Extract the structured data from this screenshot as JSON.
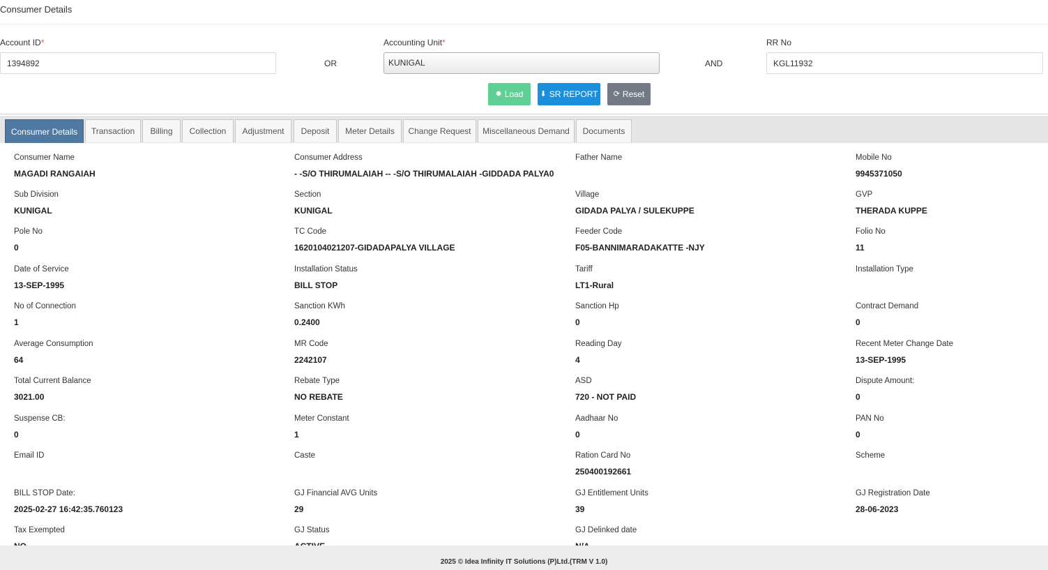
{
  "page": {
    "title": "Consumer Details"
  },
  "form": {
    "account_id": {
      "label": "Account ID",
      "required_mark": "*",
      "value": "1394892"
    },
    "or_text": "OR",
    "accounting_unit": {
      "label": "Accounting Unit",
      "required_mark": "*",
      "selected": "KUNIGAL"
    },
    "and_text": "AND",
    "rr_no": {
      "label": "RR No",
      "value": "KGL11932"
    }
  },
  "buttons": {
    "load": {
      "label": "Load",
      "icon": "spinner-icon"
    },
    "sr_report": {
      "label": "SR REPORT",
      "icon": "arrow-circle-down-icon"
    },
    "reset": {
      "label": "Reset",
      "icon": "refresh-icon"
    }
  },
  "tabs": [
    {
      "label": "Consumer Details",
      "active": true
    },
    {
      "label": "Transaction",
      "active": false
    },
    {
      "label": "Billing",
      "active": false
    },
    {
      "label": "Collection",
      "active": false
    },
    {
      "label": "Adjustment",
      "active": false
    },
    {
      "label": "Deposit",
      "active": false
    },
    {
      "label": "Meter Details",
      "active": false
    },
    {
      "label": "Change Request",
      "active": false
    },
    {
      "label": "Miscellaneous Demand",
      "active": false
    },
    {
      "label": "Documents",
      "active": false
    }
  ],
  "details": [
    [
      {
        "label": "Consumer Name",
        "value": "MAGADI RANGAIAH"
      },
      {
        "label": "Consumer Address",
        "value": "- -S/O THIRUMALAIAH -- -S/O THIRUMALAIAH -GIDDADA PALYA0"
      },
      {
        "label": "Father Name",
        "value": ""
      },
      {
        "label": "Mobile No",
        "value": "9945371050"
      }
    ],
    [
      {
        "label": "Sub Division",
        "value": "KUNIGAL"
      },
      {
        "label": "Section",
        "value": "KUNIGAL"
      },
      {
        "label": "Village",
        "value": "GIDADA PALYA / SULEKUPPE"
      },
      {
        "label": "GVP",
        "value": "THERADA KUPPE"
      }
    ],
    [
      {
        "label": "Pole No",
        "value": "0"
      },
      {
        "label": "TC Code",
        "value": "1620104021207-GIDADAPALYA VILLAGE"
      },
      {
        "label": "Feeder Code",
        "value": "F05-BANNIMARADAKATTE -NJY"
      },
      {
        "label": "Folio No",
        "value": "11"
      }
    ],
    [
      {
        "label": "Date of Service",
        "value": "13-SEP-1995"
      },
      {
        "label": "Installation Status",
        "value": "BILL STOP"
      },
      {
        "label": "Tariff",
        "value": "LT1-Rural"
      },
      {
        "label": "Installation Type",
        "value": ""
      }
    ],
    [
      {
        "label": "No of Connection",
        "value": "1"
      },
      {
        "label": "Sanction KWh",
        "value": "0.2400"
      },
      {
        "label": "Sanction Hp",
        "value": "0"
      },
      {
        "label": "Contract Demand",
        "value": "0"
      }
    ],
    [
      {
        "label": "Average Consumption",
        "value": "64"
      },
      {
        "label": "MR Code",
        "value": "2242107"
      },
      {
        "label": "Reading Day",
        "value": "4"
      },
      {
        "label": "Recent Meter Change Date",
        "value": "13-SEP-1995"
      }
    ],
    [
      {
        "label": "Total Current Balance",
        "value": "3021.00"
      },
      {
        "label": "Rebate Type",
        "value": "NO REBATE"
      },
      {
        "label": "ASD",
        "value": "720 - NOT PAID"
      },
      {
        "label": "Dispute Amount:",
        "value": "0"
      }
    ],
    [
      {
        "label": "Suspense CB:",
        "value": "0"
      },
      {
        "label": "Meter Constant",
        "value": "1"
      },
      {
        "label": "Aadhaar No",
        "value": "0"
      },
      {
        "label": "PAN No",
        "value": "0"
      }
    ],
    [
      {
        "label": "Email ID",
        "value": ""
      },
      {
        "label": "Caste",
        "value": ""
      },
      {
        "label": "Ration Card No",
        "value": "250400192661"
      },
      {
        "label": "Scheme",
        "value": ""
      }
    ],
    [
      {
        "label": "BILL STOP Date:",
        "value": "2025-02-27 16:42:35.760123"
      },
      {
        "label": "GJ Financial AVG Units",
        "value": "29"
      },
      {
        "label": "GJ Entitlement Units",
        "value": "39"
      },
      {
        "label": "GJ Registration Date",
        "value": "28-06-2023"
      }
    ],
    [
      {
        "label": "Tax Exempted",
        "value": "NO"
      },
      {
        "label": "GJ Status",
        "value": "ACTIVE"
      },
      {
        "label": "GJ Delinked date",
        "value": "N/A"
      }
    ]
  ],
  "footer": {
    "text": "2025 © Idea Infinity IT Solutions (P)Ltd.(TRM V 1.0)"
  }
}
